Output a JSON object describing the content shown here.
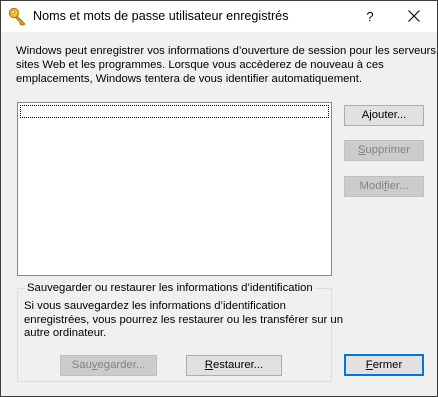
{
  "window": {
    "title": "Noms et mots de passe utilisateur enregistrés",
    "help_label": "?",
    "close_label": "Close"
  },
  "description": {
    "line1": "Windows peut enregistrer vos informations d’ouverture de session pour les serveurs, les",
    "line2": "sites Web et les programmes. Lorsque vous accèderez de nouveau à ces",
    "line3": "emplacements, Windows tentera de vous identifier automatiquement."
  },
  "credentials_list": {
    "items": []
  },
  "side_buttons": {
    "add": {
      "pre": "A",
      "key": "j",
      "post": "outer...",
      "enabled": true
    },
    "remove": {
      "pre": "",
      "key": "S",
      "post": "upprimer",
      "enabled": false
    },
    "modify": {
      "pre": "Modi",
      "key": "f",
      "post": "ier...",
      "enabled": false
    }
  },
  "backup_group": {
    "legend": "Sauvegarder ou restaurer les informations d’identification",
    "line1": "Si vous sauvegardez les informations d’identification",
    "line2": "enregistrées, vous pourrez les restaurer ou les transférer sur un",
    "line3": "autre ordinateur."
  },
  "bottom_buttons": {
    "backup": {
      "pre": "Sau",
      "key": "v",
      "post": "egarder...",
      "enabled": false
    },
    "restore": {
      "pre": "",
      "key": "R",
      "post": "estaurer...",
      "enabled": true
    },
    "close": {
      "pre": "",
      "key": "F",
      "post": "ermer",
      "enabled": true
    }
  },
  "colors": {
    "dialog_bg": "#f0f0f0",
    "button_bg": "#e1e1e1",
    "default_button_border": "#0078d7",
    "disabled_text": "#838383"
  }
}
